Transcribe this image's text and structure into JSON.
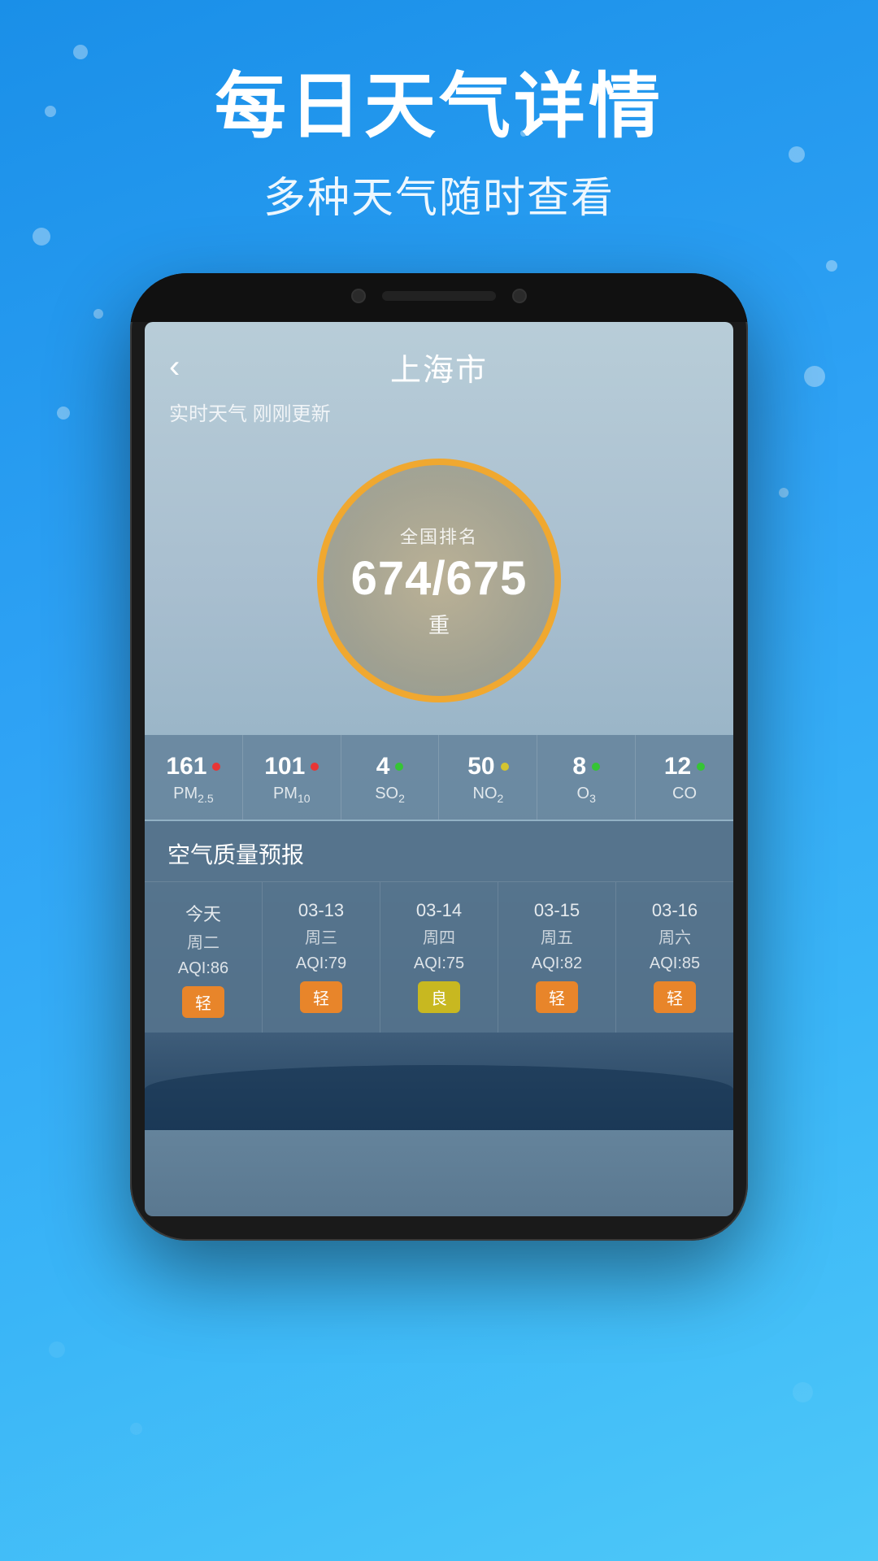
{
  "background": {
    "color_start": "#1a8fe8",
    "color_end": "#4dc8f8"
  },
  "header": {
    "title": "每日天气详情",
    "subtitle": "多种天气随时查看"
  },
  "app": {
    "city": "上海市",
    "update_status": "实时天气 刚刚更新",
    "back_button": "‹",
    "aqi_label": "全国排名",
    "aqi_value": "674/675",
    "aqi_level": "重",
    "pollutants": [
      {
        "value": "161",
        "dot_class": "dot-red",
        "name": "PM",
        "sub": "2.5"
      },
      {
        "value": "101",
        "dot_class": "dot-red",
        "name": "PM",
        "sub": "10"
      },
      {
        "value": "4",
        "dot_class": "dot-green",
        "name": "SO",
        "sub": "2"
      },
      {
        "value": "50",
        "dot_class": "dot-yellow",
        "name": "NO",
        "sub": "2"
      },
      {
        "value": "8",
        "dot_class": "dot-green",
        "name": "O",
        "sub": "3"
      },
      {
        "value": "12",
        "dot_class": "dot-green",
        "name": "CO",
        "sub": ""
      }
    ],
    "forecast_title": "空气质量预报",
    "forecast": [
      {
        "date": "今天",
        "day": "周二",
        "aqi": "AQI:86",
        "level": "轻",
        "badge_class": "badge-orange"
      },
      {
        "date": "03-13",
        "day": "周三",
        "aqi": "AQI:79",
        "level": "轻",
        "badge_class": "badge-orange"
      },
      {
        "date": "03-14",
        "day": "周四",
        "aqi": "AQI:75",
        "level": "良",
        "badge_class": "badge-yellow"
      },
      {
        "date": "03-15",
        "day": "周五",
        "aqi": "AQI:82",
        "level": "轻",
        "badge_class": "badge-orange"
      },
      {
        "date": "03-16",
        "day": "周六",
        "aqi": "AQI:85",
        "level": "轻",
        "badge_class": "badge-orange"
      }
    ]
  }
}
